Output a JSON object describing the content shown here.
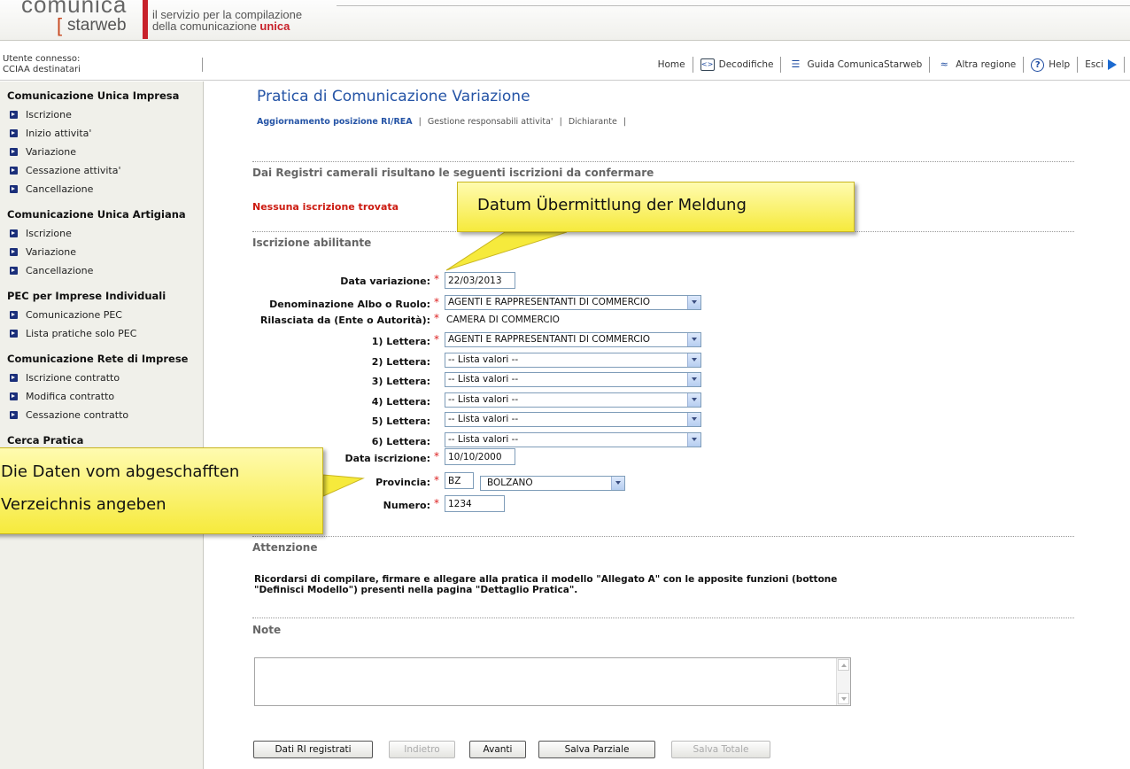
{
  "header": {
    "logo_top": "comunica",
    "logo_bracket": "[",
    "logo_name": "starweb",
    "tagline_line1": "il servizio per la compilazione",
    "tagline_line2_prefix": "della comunicazione ",
    "tagline_line2_accent": "unica"
  },
  "userbar": {
    "user_label": "Utente connesso:",
    "cciaa_label": "CCIAA destinatari"
  },
  "nav": {
    "home": "Home",
    "decodifiche": "Decodifiche",
    "guida": "Guida ComunicaStarweb",
    "altra_regione": "Altra regione",
    "help": "Help",
    "esci": "Esci"
  },
  "sidebar": {
    "sections": [
      {
        "title": "Comunicazione Unica Impresa",
        "items": [
          "Iscrizione",
          "Inizio attivita'",
          "Variazione",
          "Cessazione attivita'",
          "Cancellazione"
        ]
      },
      {
        "title": "Comunicazione Unica Artigiana",
        "items": [
          "Iscrizione",
          "Variazione",
          "Cancellazione"
        ]
      },
      {
        "title": "PEC per Imprese Individuali",
        "items": [
          "Comunicazione PEC",
          "Lista pratiche solo PEC"
        ]
      },
      {
        "title": "Comunicazione Rete di Imprese",
        "items": [
          "Iscrizione contratto",
          "Modifica contratto",
          "Cessazione contratto"
        ]
      },
      {
        "title": "Cerca Pratica",
        "items": []
      }
    ]
  },
  "page": {
    "title": "Pratica di Comunicazione Variazione",
    "subnav": {
      "active": "Aggiornamento posizione RI/REA",
      "item2": "Gestione responsabili attivita'",
      "item3": "Dichiarante",
      "sep": "|"
    },
    "section_registri": "Dai Registri camerali risultano le seguenti iscrizioni da confermare",
    "not_found": "Nessuna iscrizione trovata",
    "section_abilitante": "Iscrizione abilitante",
    "section_attenzione": "Attenzione",
    "attenzione_text": "Ricordarsi di compilare, firmare e allegare alla pratica il modello \"Allegato A\" con le apposite funzioni (bottone \"Definisci Modello\") presenti nella pagina \"Dettaglio Pratica\".",
    "section_note": "Note"
  },
  "form": {
    "required_mark": "*",
    "data_variazione": {
      "label": "Data variazione:",
      "value": "22/03/2013"
    },
    "denominazione": {
      "label": "Denominazione Albo o Ruolo:",
      "value": "AGENTI E RAPPRESENTANTI DI COMMERCIO"
    },
    "rilasciata": {
      "label": "Rilasciata da (Ente o Autorità):",
      "value": "CAMERA DI COMMERCIO"
    },
    "lettere": [
      {
        "label": "1) Lettera:",
        "value": "AGENTI E RAPPRESENTANTI DI COMMERCIO",
        "required": true
      },
      {
        "label": "2) Lettera:",
        "value": "-- Lista valori --",
        "required": false
      },
      {
        "label": "3) Lettera:",
        "value": "-- Lista valori --",
        "required": false
      },
      {
        "label": "4) Lettera:",
        "value": "-- Lista valori --",
        "required": false
      },
      {
        "label": "5) Lettera:",
        "value": "-- Lista valori --",
        "required": false
      },
      {
        "label": "6) Lettera:",
        "value": "-- Lista valori --",
        "required": false
      }
    ],
    "data_iscrizione": {
      "label": "Data iscrizione:",
      "value": "10/10/2000"
    },
    "provincia": {
      "label": "Provincia:",
      "code": "BZ",
      "name": "BOLZANO"
    },
    "numero": {
      "label": "Numero:",
      "value": "1234"
    }
  },
  "buttons": {
    "dati_ri": "Dati RI registrati",
    "indietro": "Indietro",
    "avanti": "Avanti",
    "salva_parziale": "Salva Parziale",
    "salva_totale": "Salva Totale"
  },
  "callouts": {
    "datum": "Datum Übermittlung der Meldung",
    "verzeichnis_line1": "Die Daten vom abgeschafften",
    "verzeichnis_line2": "Verzeichnis angeben"
  },
  "colors": {
    "brand_red": "#c8222b",
    "title_blue": "#2554a6",
    "error_red": "#cc1a10",
    "callout_yellow": "#f6ea3c"
  }
}
